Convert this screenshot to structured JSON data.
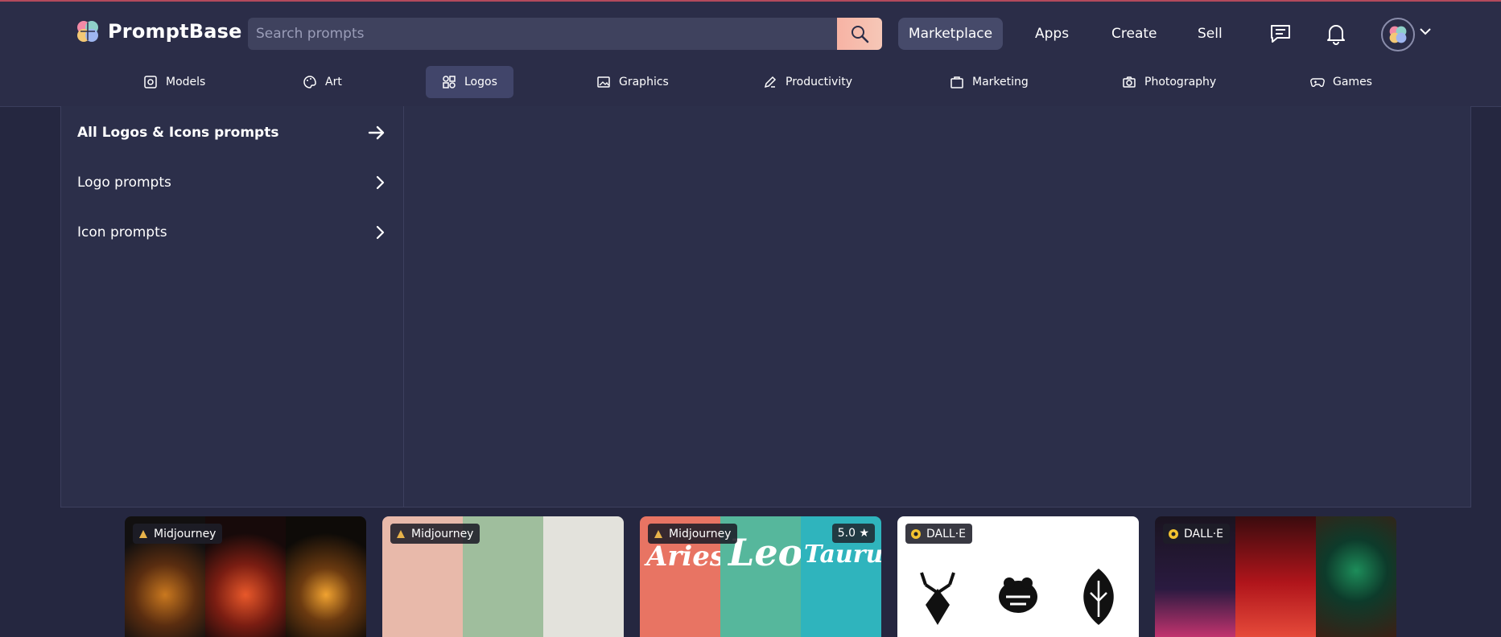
{
  "header": {
    "brand": "PromptBase",
    "search_placeholder": "Search prompts",
    "nav": [
      "Marketplace",
      "Apps",
      "Create",
      "Sell"
    ]
  },
  "categories": [
    {
      "label": "Models",
      "icon": "models-icon"
    },
    {
      "label": "Art",
      "icon": "palette-icon"
    },
    {
      "label": "Logos",
      "icon": "logos-icon",
      "active": true
    },
    {
      "label": "Graphics",
      "icon": "image-icon"
    },
    {
      "label": "Productivity",
      "icon": "pen-icon"
    },
    {
      "label": "Marketing",
      "icon": "briefcase-icon"
    },
    {
      "label": "Photography",
      "icon": "camera-icon"
    },
    {
      "label": "Games",
      "icon": "gamepad-icon"
    }
  ],
  "dropdown": {
    "all_label": "All Logos & Icons prompts",
    "items": [
      "Logo prompts",
      "Icon prompts"
    ]
  },
  "cards": [
    {
      "model": "Midjourney",
      "icon": "midjourney-icon"
    },
    {
      "model": "Midjourney",
      "icon": "midjourney-icon"
    },
    {
      "model": "Midjourney",
      "icon": "midjourney-icon",
      "rating": "5.0 ★",
      "words": [
        "Aries",
        "Leo",
        "Taurus"
      ]
    },
    {
      "model": "DALL·E",
      "icon": "dalle-icon"
    },
    {
      "model": "DALL·E",
      "icon": "dalle-icon"
    }
  ],
  "colors": {
    "background": "#252740",
    "header": "#2b2d48",
    "accent": "#f7b3a4"
  }
}
